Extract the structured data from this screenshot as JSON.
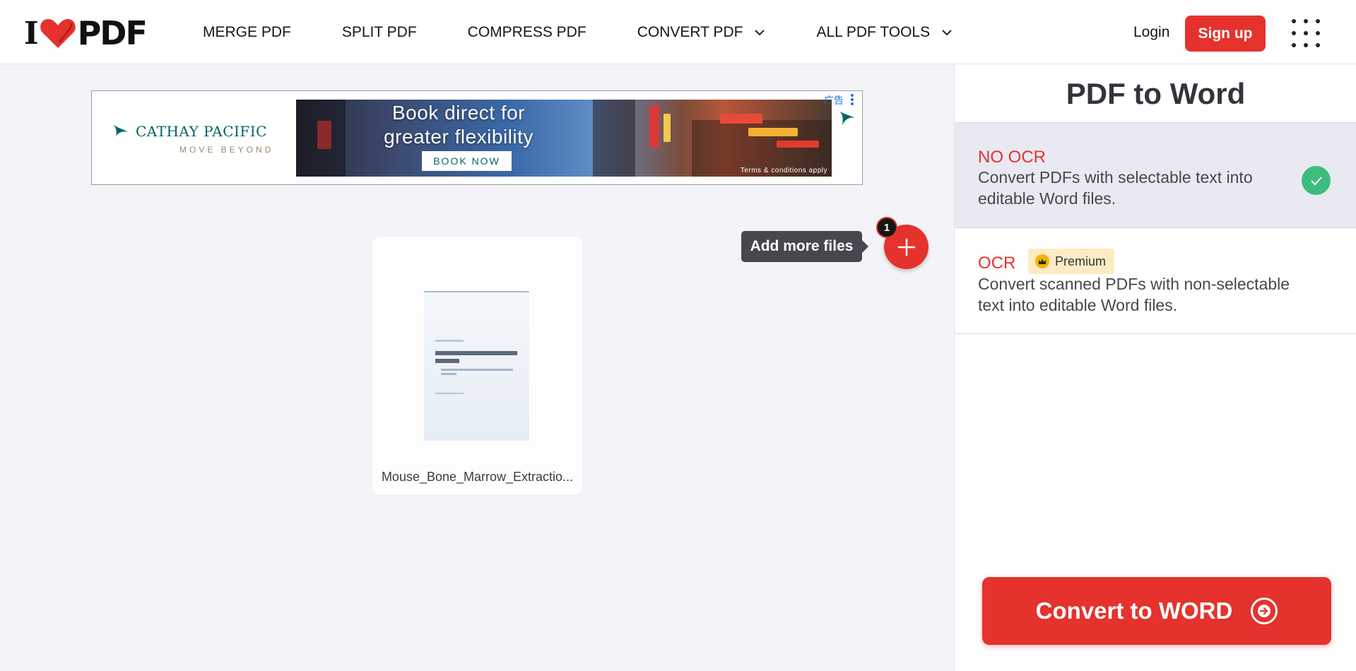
{
  "header": {
    "logo_left": "I",
    "logo_right": "PDF",
    "nav": [
      {
        "label": "MERGE PDF",
        "has_dropdown": false
      },
      {
        "label": "SPLIT PDF",
        "has_dropdown": false
      },
      {
        "label": "COMPRESS PDF",
        "has_dropdown": false
      },
      {
        "label": "CONVERT PDF",
        "has_dropdown": true
      },
      {
        "label": "ALL PDF TOOLS",
        "has_dropdown": true
      }
    ],
    "login_label": "Login",
    "signup_label": "Sign up",
    "apps_icon": "grid-icon"
  },
  "ad": {
    "brand_name": "CATHAY PACIFIC",
    "brand_tagline": "MOVE BEYOND",
    "headline": "Book direct for greater flexibility",
    "cta": "BOOK NOW",
    "terms": "Terms & conditions apply",
    "ad_label": "广告"
  },
  "files": {
    "items": [
      {
        "name": "Mouse_Bone_Marrow_Extractio..."
      }
    ],
    "count": "1",
    "add_more_label": "Add more files"
  },
  "sidebar": {
    "title": "PDF to Word",
    "options": [
      {
        "title": "NO OCR",
        "description": "Convert PDFs with selectable text into editable Word files.",
        "selected": true
      },
      {
        "title": "OCR",
        "badge": "Premium",
        "description": "Convert scanned PDFs with non-selectable text into editable Word files.",
        "selected": false
      }
    ],
    "convert_label": "Convert to WORD"
  },
  "colors": {
    "brand_red": "#e5322d",
    "check_green": "#3dbd7d",
    "premium_bg": "#fdebc3",
    "selected_bg": "#e9e9f2"
  }
}
